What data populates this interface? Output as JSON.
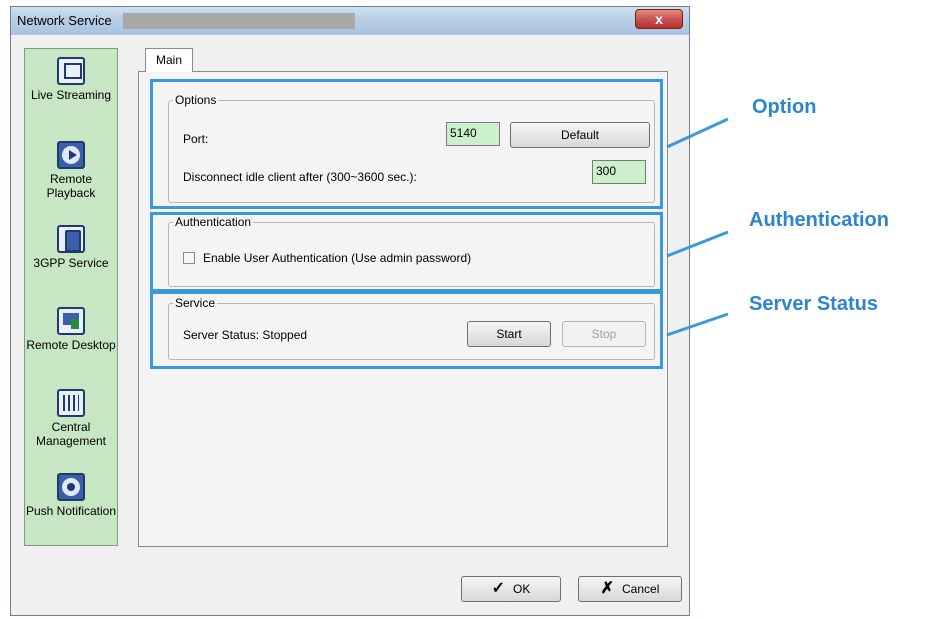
{
  "window": {
    "title": "Network Service",
    "close_glyph": "x"
  },
  "sidebar": {
    "items": [
      {
        "label": "Live Streaming",
        "icon": "live-streaming-icon"
      },
      {
        "label": "Remote Playback",
        "icon": "remote-playback-icon"
      },
      {
        "label": "3GPP Service",
        "icon": "3gpp-service-icon"
      },
      {
        "label": "Remote Desktop",
        "icon": "remote-desktop-icon"
      },
      {
        "label": "Central Management",
        "icon": "central-management-icon"
      },
      {
        "label": "Push Notification",
        "icon": "push-notification-icon"
      }
    ]
  },
  "tabs": {
    "main": "Main"
  },
  "options": {
    "legend": "Options",
    "port_label": "Port:",
    "port_value": "5140",
    "default_button": "Default",
    "idle_label": "Disconnect idle client after (300~3600 sec.):",
    "idle_value": "300"
  },
  "authentication": {
    "legend": "Authentication",
    "checkbox_label": "Enable User Authentication (Use admin password)",
    "checked": false
  },
  "service": {
    "legend": "Service",
    "status_text": "Server Status: Stopped",
    "start_button": "Start",
    "stop_button": "Stop"
  },
  "footer": {
    "ok_label": "OK",
    "cancel_label": "Cancel"
  },
  "callouts": {
    "option": "Option",
    "authentication": "Authentication",
    "server_status": "Server Status"
  },
  "colors": {
    "highlight": "#3a9ad9",
    "callout_text": "#2e84cf",
    "field_bg": "#ccf0cc",
    "sidebar_bg": "#c6e6c4"
  }
}
